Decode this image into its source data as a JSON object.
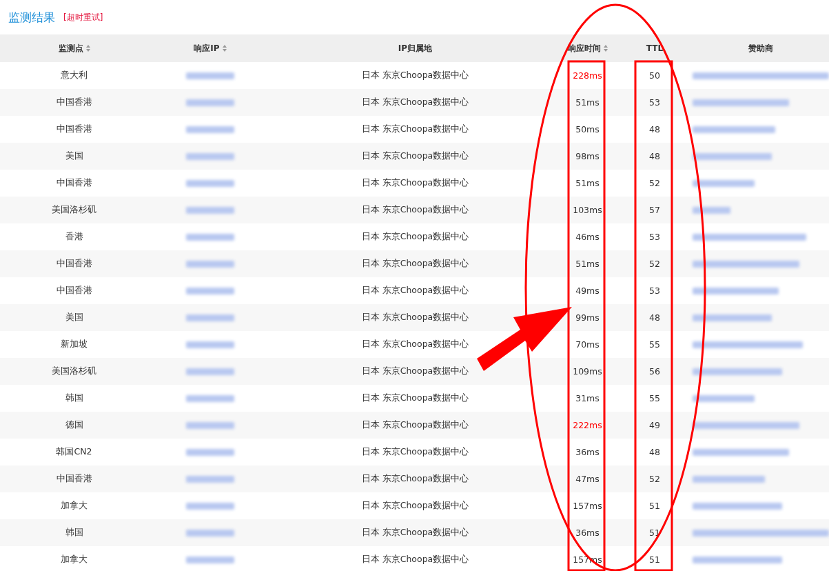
{
  "title": "监测结果",
  "retry_link": "[超时重试]",
  "columns": [
    {
      "label": "监测点",
      "sortable": true
    },
    {
      "label": "响应IP",
      "sortable": true
    },
    {
      "label": "IP归属地"
    },
    {
      "label": "响应时间",
      "sortable": true
    },
    {
      "label": "TTL"
    },
    {
      "label": "赞助商"
    }
  ],
  "rows": [
    {
      "node": "意大利",
      "location": "日本 东京Choopa数据中心",
      "time": "228ms",
      "slow": true,
      "ttl": "50"
    },
    {
      "node": "中国香港",
      "location": "日本 东京Choopa数据中心",
      "time": "51ms",
      "slow": false,
      "ttl": "53"
    },
    {
      "node": "中国香港",
      "location": "日本 东京Choopa数据中心",
      "time": "50ms",
      "slow": false,
      "ttl": "48"
    },
    {
      "node": "美国",
      "location": "日本 东京Choopa数据中心",
      "time": "98ms",
      "slow": false,
      "ttl": "48"
    },
    {
      "node": "中国香港",
      "location": "日本 东京Choopa数据中心",
      "time": "51ms",
      "slow": false,
      "ttl": "52"
    },
    {
      "node": "美国洛杉矶",
      "location": "日本 东京Choopa数据中心",
      "time": "103ms",
      "slow": false,
      "ttl": "57"
    },
    {
      "node": "香港",
      "location": "日本 东京Choopa数据中心",
      "time": "46ms",
      "slow": false,
      "ttl": "53"
    },
    {
      "node": "中国香港",
      "location": "日本 东京Choopa数据中心",
      "time": "51ms",
      "slow": false,
      "ttl": "52"
    },
    {
      "node": "中国香港",
      "location": "日本 东京Choopa数据中心",
      "time": "49ms",
      "slow": false,
      "ttl": "53"
    },
    {
      "node": "美国",
      "location": "日本 东京Choopa数据中心",
      "time": "99ms",
      "slow": false,
      "ttl": "48"
    },
    {
      "node": "新加坡",
      "location": "日本 东京Choopa数据中心",
      "time": "70ms",
      "slow": false,
      "ttl": "55"
    },
    {
      "node": "美国洛杉矶",
      "location": "日本 东京Choopa数据中心",
      "time": "109ms",
      "slow": false,
      "ttl": "56"
    },
    {
      "node": "韩国",
      "location": "日本 东京Choopa数据中心",
      "time": "31ms",
      "slow": false,
      "ttl": "55"
    },
    {
      "node": "德国",
      "location": "日本 东京Choopa数据中心",
      "time": "222ms",
      "slow": true,
      "ttl": "49"
    },
    {
      "node": "韩国CN2",
      "location": "日本 东京Choopa数据中心",
      "time": "36ms",
      "slow": false,
      "ttl": "48"
    },
    {
      "node": "中国香港",
      "location": "日本 东京Choopa数据中心",
      "time": "47ms",
      "slow": false,
      "ttl": "52"
    },
    {
      "node": "加拿大",
      "location": "日本 东京Choopa数据中心",
      "time": "157ms",
      "slow": false,
      "ttl": "51"
    },
    {
      "node": "韩国",
      "location": "日本 东京Choopa数据中心",
      "time": "36ms",
      "slow": false,
      "ttl": "51"
    },
    {
      "node": "加拿大",
      "location": "日本 东京Choopa数据中心",
      "time": "157ms",
      "slow": false,
      "ttl": "51"
    }
  ]
}
